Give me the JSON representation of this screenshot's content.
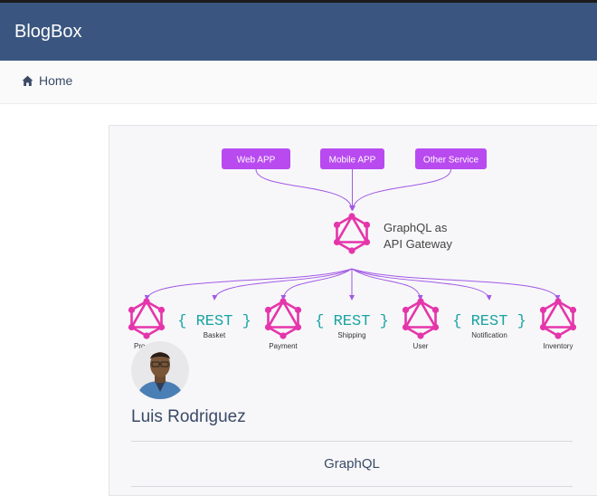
{
  "app": {
    "brand": "BlogBox"
  },
  "breadcrumb": {
    "home_label": "Home",
    "home_icon": "home-icon"
  },
  "diagram": {
    "clients": [
      "Web APP",
      "Mobile APP",
      "Other Service"
    ],
    "gateway": {
      "line1": "GraphQL as",
      "line2": "API Gateway"
    },
    "services": [
      {
        "kind": "graphql",
        "label": "Pro"
      },
      {
        "kind": "rest",
        "label": "Basket"
      },
      {
        "kind": "graphql",
        "label": "Payment"
      },
      {
        "kind": "rest",
        "label": "Shipping"
      },
      {
        "kind": "graphql",
        "label": "User"
      },
      {
        "kind": "rest",
        "label": "Notification"
      },
      {
        "kind": "graphql",
        "label": "Inventory"
      }
    ],
    "rest_text": "{ REST }",
    "colors": {
      "client_box": "#b84af0",
      "graphql_pink": "#e535ab",
      "arrow": "#a259e6",
      "rest_teal": "#1aa3a3"
    }
  },
  "author": {
    "name": "Luis Rodriguez"
  },
  "post": {
    "tag": "GraphQL"
  },
  "colors": {
    "navbar": "#3a5680",
    "text_dark": "#3a4a66"
  }
}
